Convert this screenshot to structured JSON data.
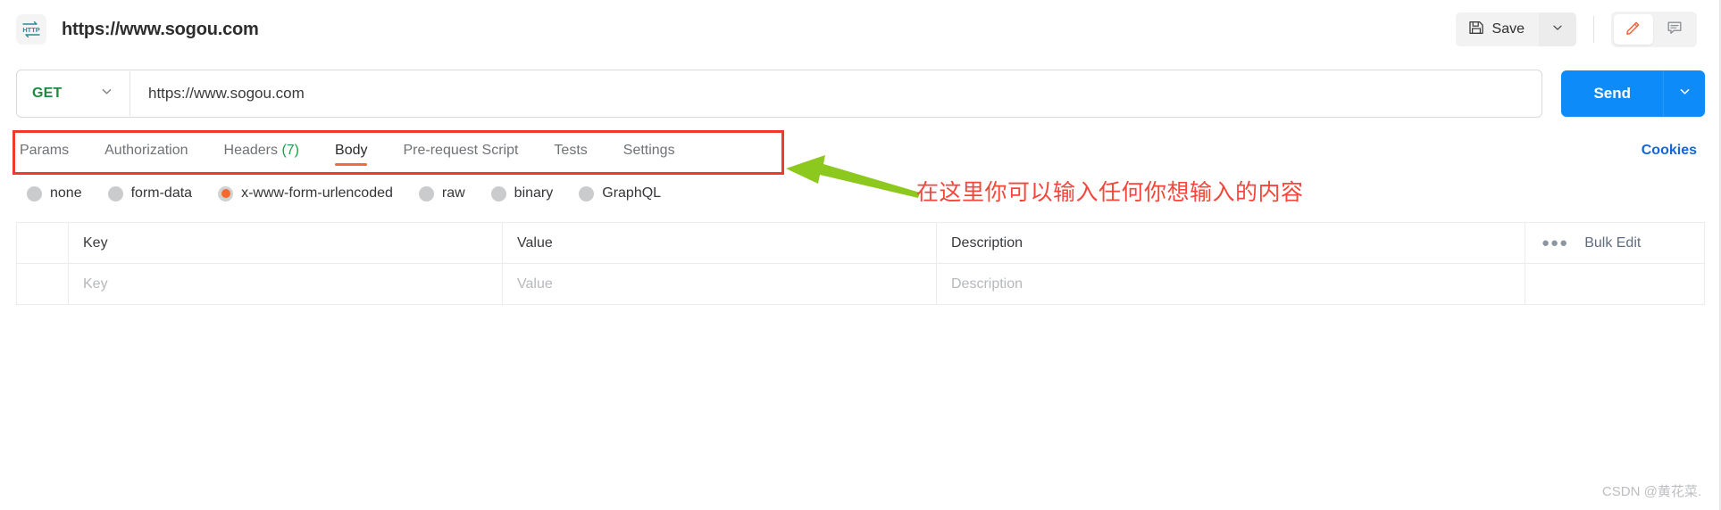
{
  "header": {
    "icon": "http-icon",
    "title": "https://www.sogou.com",
    "save_label": "Save",
    "save_icon": "floppy-disk-icon",
    "save_caret_icon": "chevron-down-icon",
    "edit_icon": "pencil-icon",
    "comment_icon": "comment-icon"
  },
  "request": {
    "method": "GET",
    "method_caret_icon": "chevron-down-icon",
    "url": "https://www.sogou.com",
    "url_placeholder": "Enter request URL",
    "send_label": "Send",
    "send_caret_icon": "chevron-down-icon"
  },
  "tabs": {
    "items": [
      {
        "label": "Params",
        "count": "",
        "active": false
      },
      {
        "label": "Authorization",
        "count": "",
        "active": false
      },
      {
        "label": "Headers",
        "count": "(7)",
        "active": false
      },
      {
        "label": "Body",
        "count": "",
        "active": true
      },
      {
        "label": "Pre-request Script",
        "count": "",
        "active": false
      },
      {
        "label": "Tests",
        "count": "",
        "active": false
      },
      {
        "label": "Settings",
        "count": "",
        "active": false
      }
    ],
    "cookies_label": "Cookies"
  },
  "body_types": [
    {
      "label": "none",
      "selected": false
    },
    {
      "label": "form-data",
      "selected": false
    },
    {
      "label": "x-www-form-urlencoded",
      "selected": true
    },
    {
      "label": "raw",
      "selected": false
    },
    {
      "label": "binary",
      "selected": false
    },
    {
      "label": "GraphQL",
      "selected": false
    }
  ],
  "table": {
    "headers": {
      "key": "Key",
      "value": "Value",
      "description": "Description",
      "bulk_edit": "Bulk Edit",
      "menu_icon": "ellipsis-icon"
    },
    "rows": [
      {
        "key": "Key",
        "value": "Value",
        "description": "Description"
      }
    ]
  },
  "annotations": {
    "note_text": "在这里你可以输入任何你想输入的内容",
    "note_color": "#f5463c",
    "box_color": "#ef3b2d",
    "arrow_color": "#8cc81e"
  },
  "watermark": "CSDN @黄花菜."
}
